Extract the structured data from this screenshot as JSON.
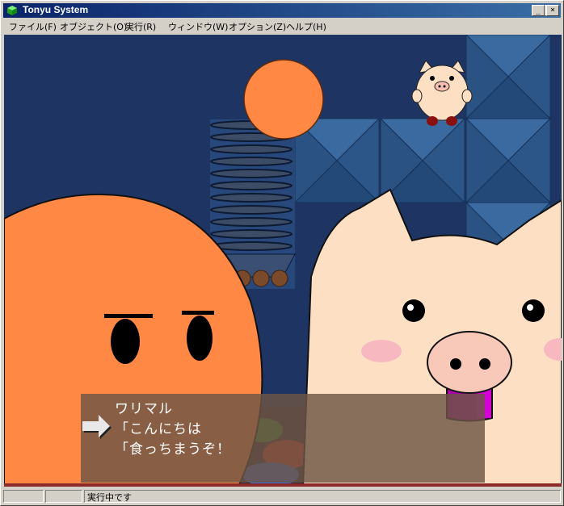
{
  "window": {
    "title": "Tonyu System",
    "controls": {
      "minimize": "_",
      "maximize": "□",
      "close": "×"
    }
  },
  "menu": {
    "items": [
      {
        "label": "ファイル(F)"
      },
      {
        "label": "オブジェクト(O)"
      },
      {
        "label": "実行(R)"
      },
      {
        "label": "ウィンドウ(W)"
      },
      {
        "label": "オプション(Z)"
      },
      {
        "label": "ヘルプ(H)"
      }
    ]
  },
  "dialog": {
    "speaker": "ワリマル",
    "line1": "「こんにちは",
    "line2": "「食っちまうぞ！"
  },
  "status": {
    "text": "実行中です"
  },
  "colors": {
    "sky": "#1e3564",
    "orange": "#ff8844",
    "pig": "#fde0c4",
    "tile": "#2e5585",
    "dialog": "#6e5546"
  },
  "icons": [
    "app-cube-icon",
    "dialog-cursor-arrow-icon"
  ]
}
